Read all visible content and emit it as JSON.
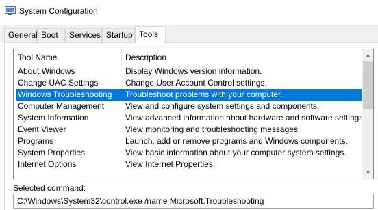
{
  "window": {
    "title": "System Configuration",
    "icon": "system-config-icon"
  },
  "tabs": [
    {
      "label": "General",
      "active": false
    },
    {
      "label": "Boot",
      "active": false
    },
    {
      "label": "Services",
      "active": false
    },
    {
      "label": "Startup",
      "active": false
    },
    {
      "label": "Tools",
      "active": true
    }
  ],
  "tools_list": {
    "columns": {
      "name": "Tool Name",
      "description": "Description"
    },
    "rows": [
      {
        "name": "About Windows",
        "description": "Display Windows version information.",
        "selected": false
      },
      {
        "name": "Change UAC Settings",
        "description": "Change User Account Control settings.",
        "selected": false
      },
      {
        "name": "Windows Troubleshooting",
        "description": "Troubleshoot problems with your computer.",
        "selected": true
      },
      {
        "name": "Computer Management",
        "description": "View and configure system settings and components.",
        "selected": false
      },
      {
        "name": "System Information",
        "description": "View advanced information about hardware and software settings.",
        "selected": false
      },
      {
        "name": "Event Viewer",
        "description": "View monitoring and troubleshooting messages.",
        "selected": false
      },
      {
        "name": "Programs",
        "description": "Launch, add or remove programs and Windows components.",
        "selected": false
      },
      {
        "name": "System Properties",
        "description": "View basic information about your computer system settings.",
        "selected": false
      },
      {
        "name": "Internet Options",
        "description": "View Internet Properties.",
        "selected": false
      }
    ]
  },
  "selected_command": {
    "label": "Selected command:",
    "value": "C:\\Windows\\System32\\control.exe /name Microsoft.Troubleshooting"
  },
  "colors": {
    "selection": "#0078d7",
    "scrollbar_thumb": "#cdcdcd"
  }
}
